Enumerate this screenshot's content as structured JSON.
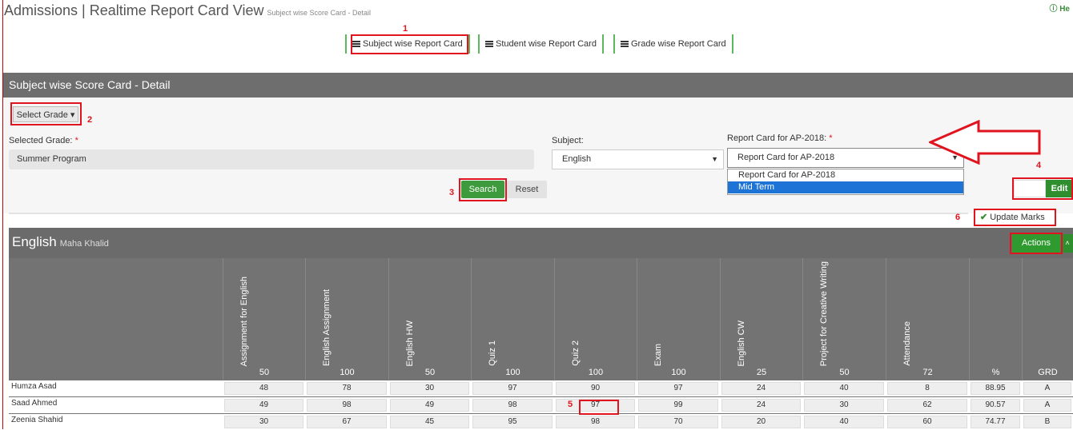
{
  "header": {
    "title": "Admissions | Realtime Report Card View",
    "subtitle": "Subject wise Score Card - Detail",
    "help": "ⓘ He"
  },
  "tabs": [
    {
      "label": "Subject wise Report Card"
    },
    {
      "label": "Student wise Report Card"
    },
    {
      "label": "Grade wise Report Card"
    }
  ],
  "panel": {
    "title": "Subject wise Score Card - Detail",
    "select_grade": "Select Grade ▾",
    "selected_grade_label": "Selected Grade:",
    "selected_grade_value": "Summer Program",
    "subject_label": "Subject:",
    "subject_value": "English",
    "report_label": "Report Card for AP-2018:",
    "report_value": "Report Card for AP-2018",
    "report_options": [
      "Report Card for AP-2018",
      "Mid Term"
    ],
    "search": "Search",
    "reset": "Reset",
    "edit": "Edit",
    "update_marks": "Update Marks",
    "required_mark": "*"
  },
  "annotations": [
    "1",
    "2",
    "3",
    "4",
    "5",
    "6"
  ],
  "section": {
    "subject": "English",
    "teacher": "Maha Khalid",
    "actions": "Actions",
    "toggle": "˄"
  },
  "columns": [
    {
      "name": "Assignment for English",
      "max": "50"
    },
    {
      "name": "English Assignment",
      "max": "100"
    },
    {
      "name": "English HW",
      "max": "50"
    },
    {
      "name": "Quiz 1",
      "max": "100"
    },
    {
      "name": "Quiz 2",
      "max": "100"
    },
    {
      "name": "Exam",
      "max": "100"
    },
    {
      "name": "English CW",
      "max": "25"
    },
    {
      "name": "Project for Creative Writing",
      "max": "50"
    },
    {
      "name": "Attendance",
      "max": "72"
    },
    {
      "name": "",
      "max": "%"
    },
    {
      "name": "",
      "max": "GRD"
    }
  ],
  "students": [
    {
      "name": "Humza Asad",
      "values": [
        "48",
        "78",
        "30",
        "97",
        "90",
        "97",
        "24",
        "40",
        "8",
        "88.95",
        "A"
      ]
    },
    {
      "name": "Saad Ahmed",
      "values": [
        "49",
        "98",
        "49",
        "98",
        "97",
        "99",
        "24",
        "30",
        "62",
        "90.57",
        "A"
      ]
    },
    {
      "name": "Zeenia Shahid",
      "values": [
        "30",
        "67",
        "45",
        "95",
        "98",
        "70",
        "20",
        "40",
        "60",
        "74.77",
        "B"
      ]
    }
  ],
  "colors": {
    "green": "#3d9a3d",
    "header_gray": "#6e6e6e",
    "annotation_red": "#e0141e",
    "selected_blue": "#1e73d7"
  }
}
